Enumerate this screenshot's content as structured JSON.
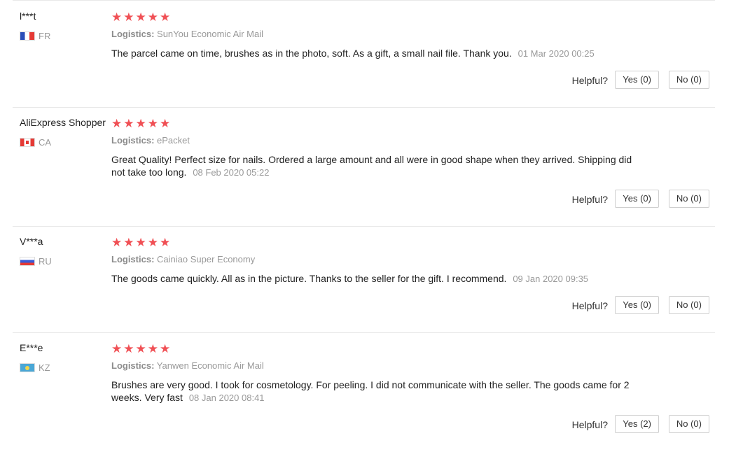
{
  "helpful_label": "Helpful?",
  "logistics_label": "Logistics:",
  "colors": {
    "star": "#f05055",
    "divider": "#e8e8e8"
  },
  "reviews": [
    {
      "user": "l***t",
      "country": "FR",
      "flag": "fr-flag-icon",
      "stars": 5,
      "logistics": "SunYou Economic Air Mail",
      "text": "The parcel came on time, brushes as in the photo, soft. As a gift, a small nail file. Thank you.",
      "date": "01 Mar 2020 00:25",
      "yes": "Yes (0)",
      "no": "No (0)"
    },
    {
      "user": "AliExpress Shopper",
      "country": "CA",
      "flag": "ca-flag-icon",
      "stars": 5,
      "logistics": "ePacket",
      "text": "Great Quality! Perfect size for nails. Ordered a large amount and all were in good shape when they arrived. Shipping did not take too long.",
      "date": "08 Feb 2020 05:22",
      "yes": "Yes (0)",
      "no": "No (0)"
    },
    {
      "user": "V***a",
      "country": "RU",
      "flag": "ru-flag-icon",
      "stars": 5,
      "logistics": "Cainiao Super Economy",
      "text": "The goods came quickly. All as in the picture. Thanks to the seller for the gift. I recommend.",
      "date": "09 Jan 2020 09:35",
      "yes": "Yes (0)",
      "no": "No (0)"
    },
    {
      "user": "E***e",
      "country": "KZ",
      "flag": "kz-flag-icon",
      "stars": 5,
      "logistics": "Yanwen Economic Air Mail",
      "text": "Brushes are very good. I took for cosmetology. For peeling. I did not communicate with the seller. The goods came for 2 weeks. Very fast",
      "date": "08 Jan 2020 08:41",
      "yes": "Yes (2)",
      "no": "No (0)"
    }
  ]
}
